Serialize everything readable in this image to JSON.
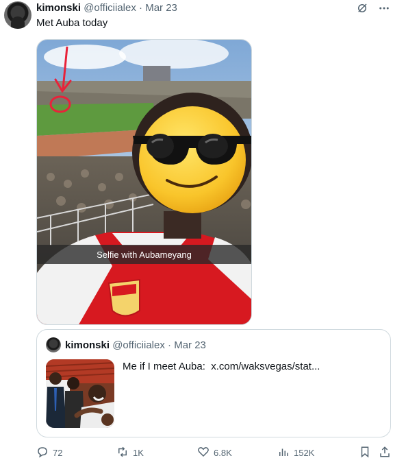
{
  "tweet": {
    "author_name": "kimonski",
    "author_handle": "@officiialex",
    "separator": " · ",
    "date": "Mar 23",
    "text": "Met Auba today",
    "media_caption": "Selfie with Aubameyang"
  },
  "quoted_tweet": {
    "author_name": "kimonski",
    "author_handle": "@officiialex",
    "separator": " · ",
    "date": "Mar 23",
    "text": "Me if I meet Auba:",
    "link": "x.com/waksvegas/stat..."
  },
  "actions": {
    "replies": "72",
    "reposts": "1K",
    "likes": "6.8K",
    "views": "152K"
  },
  "colors": {
    "text": "#0f1419",
    "muted": "#536471",
    "border": "#cfd9de",
    "arrow": "#e8223a",
    "arsenal_red": "#d71920"
  },
  "icons": [
    "grok-icon",
    "more-icon",
    "reply-icon",
    "repost-icon",
    "like-icon",
    "views-icon",
    "bookmark-icon",
    "share-icon"
  ]
}
